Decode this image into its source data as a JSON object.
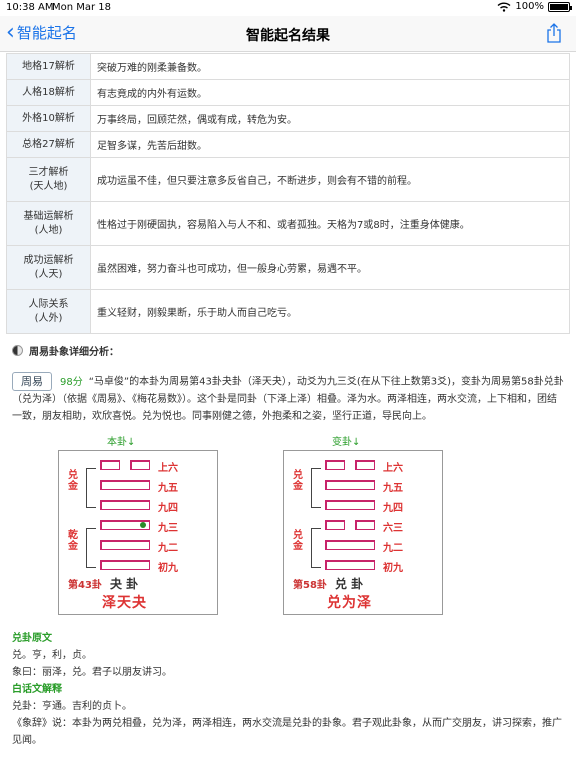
{
  "status": {
    "time": "10:38 AM",
    "date": "Mon Mar 18",
    "battery": "100%"
  },
  "nav": {
    "back_label": "智能起名",
    "title": "智能起名结果"
  },
  "analysis_table": [
    {
      "key": "地格17解析",
      "value": "突破万难的刚柔兼备数。"
    },
    {
      "key": "人格18解析",
      "value": "有志竟成的内外有运数。"
    },
    {
      "key": "外格10解析",
      "value": "万事终局，回顾茫然，偶或有成，转危为安。"
    },
    {
      "key": "总格27解析",
      "value": "足智多谋，先苦后甜数。"
    },
    {
      "key": "三才解析\n(天人地)",
      "value": "成功运虽不佳，但只要注意多反省自己，不断进步，则会有不错的前程。"
    },
    {
      "key": "基础运解析\n(人地)",
      "value": "性格过于刚硬固执，容易陷入与人不和、或者孤独。天格为7或8时，注重身体健康。"
    },
    {
      "key": "成功运解析\n(人天)",
      "value": "虽然困难，努力奋斗也可成功，但一般身心劳累，易遇不平。"
    },
    {
      "key": "人际关系\n(人外)",
      "value": "重义轻财，刚毅果断，乐于助人而自己吃亏。"
    }
  ],
  "zhouyi": {
    "section_title": "周易卦象详细分析：",
    "tag": "周易",
    "score": "98分",
    "paragraph": "“马卓俊”的本卦为周易第43卦夬卦（泽天夬），动爻为九三爻(在从下往上数第3爻)，变卦为周易第58卦兑卦（兑为泽）（依据《周易》、《梅花易数》）。这个卦是同卦（下泽上泽）相叠。泽为水。两泽相连，两水交流，上下相和，团结一致，朋友相助，欢欣喜悦。兑为悦也。同事刚健之德，外抱柔和之姿，坚行正道，导民向上。",
    "ben_label": "本卦↓",
    "bian_label": "变卦↓",
    "ben": {
      "upper_trigram": "兑金",
      "lower_trigram": "乾金",
      "lines": [
        "上六",
        "九五",
        "九四",
        "九三",
        "九二",
        "初九"
      ],
      "number": "第43卦",
      "short": "夬 卦",
      "name": "泽天夬"
    },
    "bian": {
      "upper_trigram": "兑金",
      "lower_trigram": "兑金",
      "lines": [
        "上六",
        "九五",
        "九四",
        "六三",
        "九二",
        "初九"
      ],
      "number": "第58卦",
      "short": "兑 卦",
      "name": "兑为泽"
    }
  },
  "original": {
    "head": "兑卦原文",
    "line1": "兑。亨，利，贞。",
    "line2": "象曰：丽泽，兑。君子以朋友讲习。",
    "vernacular_head": "白话文解释",
    "line3": "兑卦：亨通。吉利的贞卜。",
    "line4": "《象辞》说：本卦为两兑相叠，兑为泽，两泽相连，两水交流是兑卦的卦象。君子观此卦象，从而广交朋友，讲习探索，推广见闻。"
  }
}
